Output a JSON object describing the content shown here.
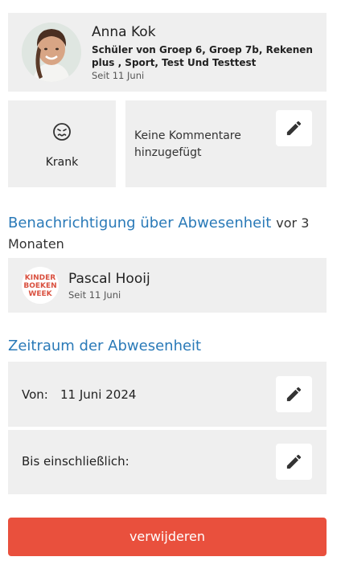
{
  "student": {
    "name": "Anna Kok",
    "groups": "Schüler von Groep 6, Groep 7b, Rekenen plus , Sport, Test Und Testtest",
    "since": "Seit 11 Juni"
  },
  "status": {
    "icon": "sick-face-icon",
    "label": "Krank"
  },
  "comment": {
    "text": "Keine Kommentare hinzugefügt"
  },
  "notification": {
    "title": "Benachrichtigung über Abwesenheit",
    "time": "vor 3 Monaten"
  },
  "reporter": {
    "name": "Pascal Hooij",
    "since": "Seit 11 Juni",
    "logo_lines": [
      "KINDER",
      "BOEKEN",
      "WEEK"
    ],
    "logo_color": "#d9503f"
  },
  "period": {
    "title": "Zeitraum der Abwesenheit",
    "from_label": "Von:",
    "from_value": "11 Juni 2024",
    "until_label": "Bis einschließlich:"
  },
  "actions": {
    "delete_label": "verwijderen"
  },
  "colors": {
    "accent": "#2a7ab8",
    "danger": "#e9503d",
    "card": "#efefef"
  }
}
